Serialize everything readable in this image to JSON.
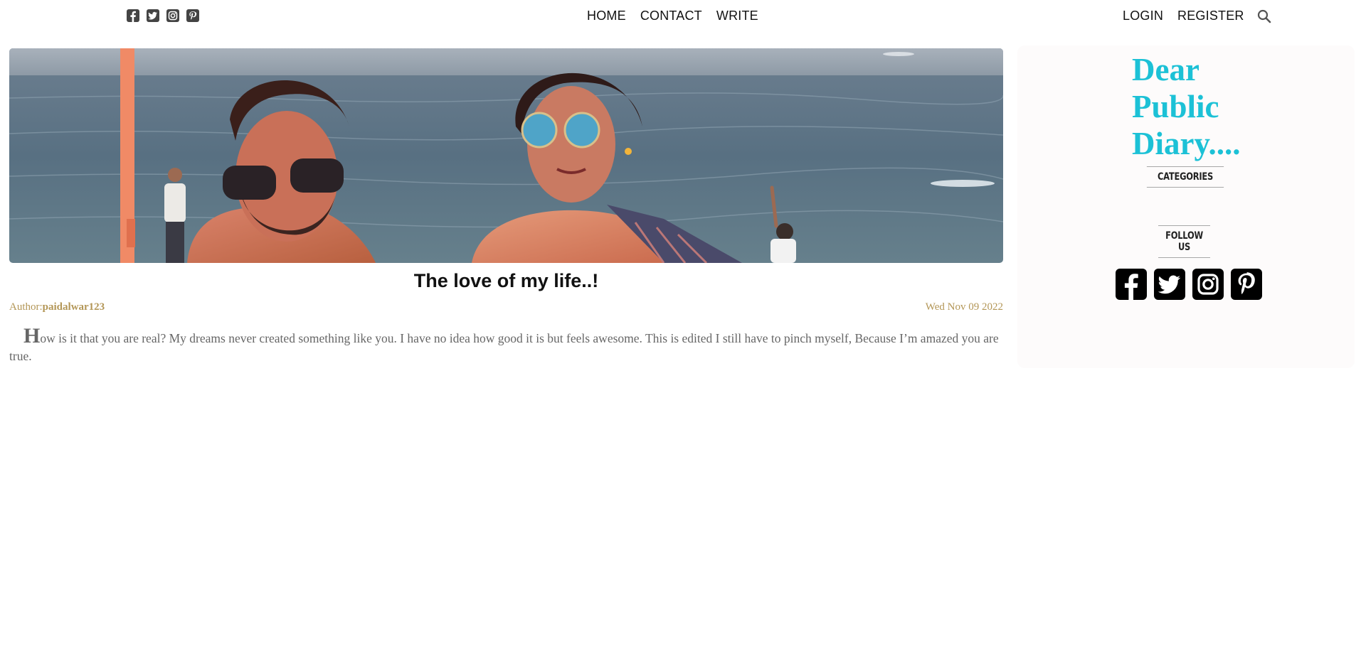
{
  "header": {
    "social_icons": [
      "facebook-icon",
      "twitter-icon",
      "instagram-icon",
      "pinterest-icon"
    ],
    "nav": [
      "HOME",
      "CONTACT",
      "WRITE"
    ],
    "account": [
      "LOGIN",
      "REGISTER"
    ],
    "search_icon": "search-icon"
  },
  "post": {
    "title": "The love of my life..!",
    "author_prefix": "Author:",
    "author_name": "paidalwar123",
    "date": "Wed Nov 09 2022",
    "dropcap": "H",
    "body": "ow is it that you are real? My dreams never created something like you. I have no idea how good it is but feels awesome. This is edited I still have to pinch myself, Because I’m amazed you are true."
  },
  "sidebar": {
    "brand_line1": "Dear",
    "brand_line2": "Public",
    "brand_line3": "Diary....",
    "categories_heading": "CATEGORIES",
    "follow_heading": "FOLLOW US",
    "social_icons": [
      "facebook-icon",
      "twitter-icon",
      "instagram-icon",
      "pinterest-icon"
    ]
  },
  "colors": {
    "brand": "#1cc1d6",
    "meta": "#b39656",
    "body_text": "#666666",
    "sidebar_bg": "#fdfbfb"
  }
}
